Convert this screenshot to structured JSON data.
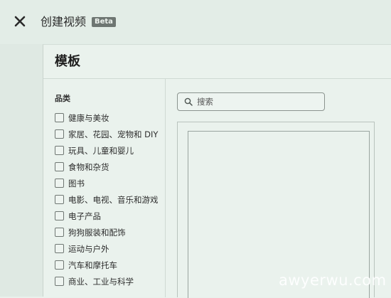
{
  "header": {
    "title": "创建视频",
    "badge": "Beta"
  },
  "panel": {
    "title": "模板"
  },
  "sidebar": {
    "section_title": "品类",
    "categories": [
      {
        "label": "健康与美妆"
      },
      {
        "label": "家居、花园、宠物和 DIY"
      },
      {
        "label": "玩具、儿童和婴儿"
      },
      {
        "label": "食物和杂货"
      },
      {
        "label": "图书"
      },
      {
        "label": "电影、电视、音乐和游戏"
      },
      {
        "label": "电子产品"
      },
      {
        "label": "狗狗服装和配饰"
      },
      {
        "label": "运动与户外"
      },
      {
        "label": "汽车和摩托车"
      },
      {
        "label": "商业、工业与科学"
      }
    ]
  },
  "search": {
    "placeholder": "搜索"
  },
  "watermark": "awyerwu.com"
}
